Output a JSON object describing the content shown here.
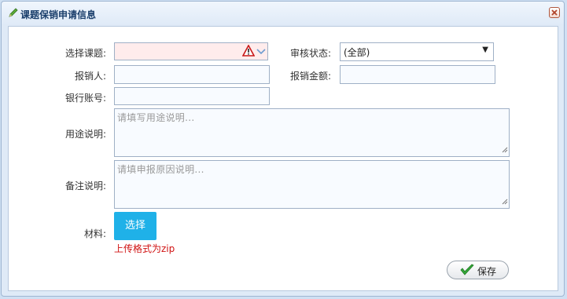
{
  "dialog": {
    "title": "课题保销申请信息",
    "close_icon": "close-x-icon"
  },
  "form": {
    "topic_label": "选择课题:",
    "topic_value": "",
    "topic_icon": "warning-icon",
    "status_label": "审核状态:",
    "status_value": "(全部)",
    "claimant_label": "报销人:",
    "claimant_value": "",
    "amount_label": "报销金额:",
    "amount_value": "",
    "account_label": "银行账号:",
    "account_value": "",
    "purpose_label": "用途说明:",
    "purpose_placeholder": "请填写用途说明...",
    "remark_label": "备注说明:",
    "remark_placeholder": "请填申报原因说明...",
    "material_label": "材料:",
    "upload_label": "选择",
    "upload_hint": "上传格式为zip",
    "save_label": "保存"
  },
  "colors": {
    "upload_button": "#1fb1e8",
    "error_fill": "#ffecec",
    "hint_text": "#d01212"
  }
}
